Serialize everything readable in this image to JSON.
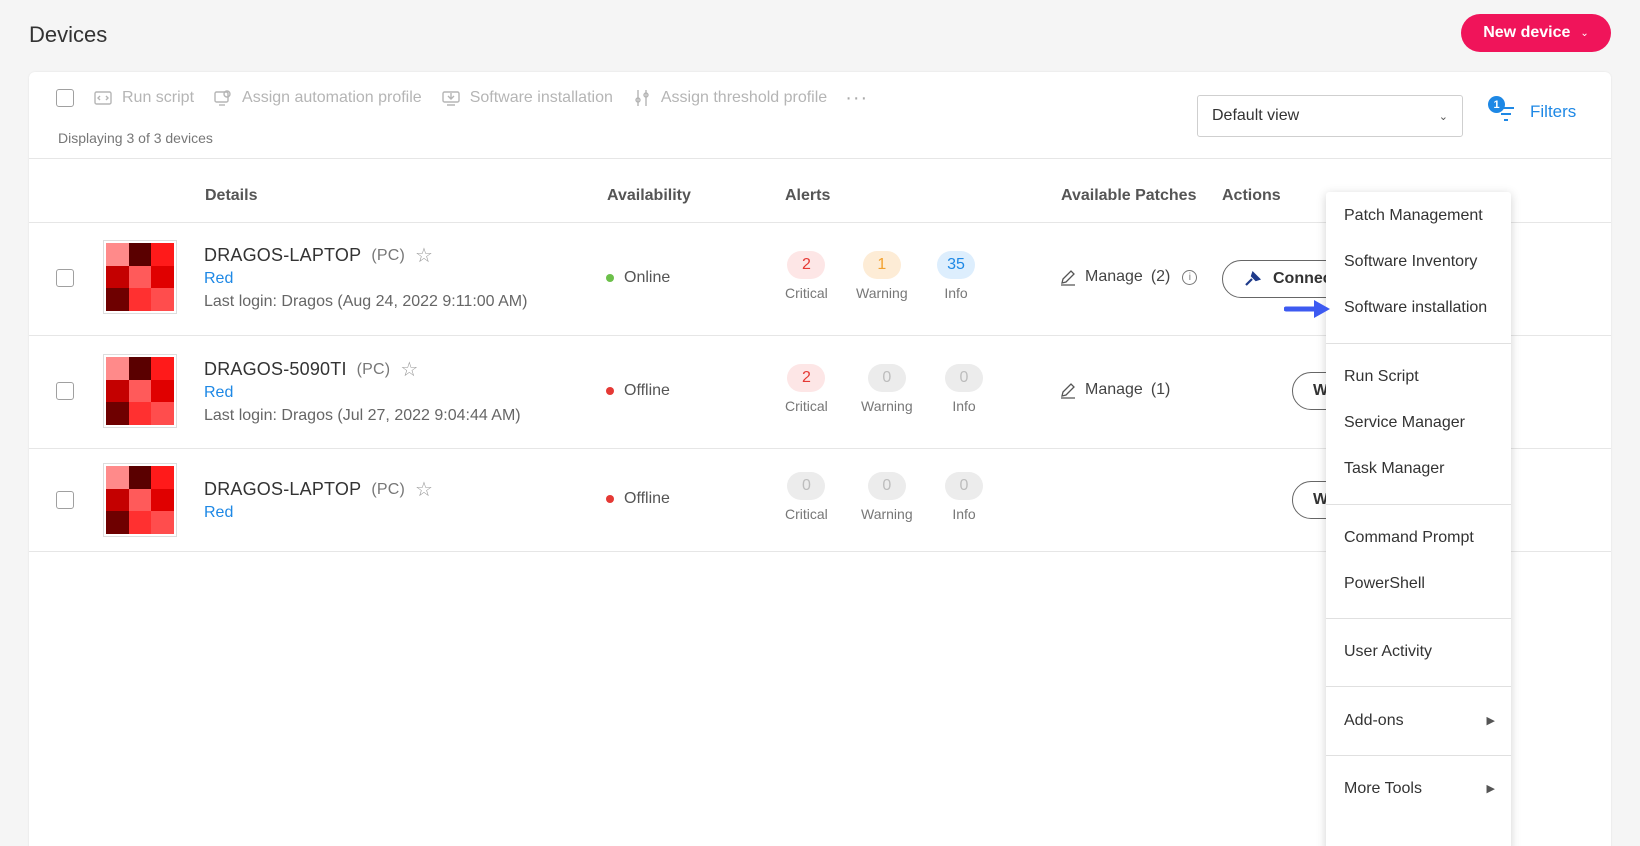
{
  "header": {
    "title": "Devices",
    "new_device_label": "New device"
  },
  "toolbar": {
    "run_script": "Run script",
    "assign_automation": "Assign automation profile",
    "software_installation": "Software installation",
    "assign_threshold": "Assign threshold profile",
    "more": "···",
    "display_count": "Displaying 3 of 3 devices"
  },
  "view": {
    "selected": "Default view"
  },
  "filters": {
    "label": "Filters",
    "count": "1"
  },
  "columns": {
    "details": "Details",
    "availability": "Availability",
    "alerts": "Alerts",
    "patches": "Available Patches",
    "actions": "Actions"
  },
  "devices": [
    {
      "name": "DRAGOS-LAPTOP",
      "type": "(PC)",
      "group": "Red",
      "last_login": "Last login: Dragos (Aug 24, 2022 9:11:00 AM)",
      "availability": "Online",
      "critical": "2",
      "warning": "1",
      "info": "35",
      "patches": "Manage",
      "patch_count": "(2)",
      "action": "Connect"
    },
    {
      "name": "DRAGOS-5090TI",
      "type": "(PC)",
      "group": "Red",
      "last_login": "Last login: Dragos (Jul 27, 2022 9:04:44 AM)",
      "availability": "Offline",
      "critical": "2",
      "warning": "0",
      "info": "0",
      "patches": "Manage",
      "patch_count": "(1)",
      "action": "W"
    },
    {
      "name": "DRAGOS-LAPTOP",
      "type": "(PC)",
      "group": "Red",
      "availability": "Offline",
      "critical": "0",
      "warning": "0",
      "info": "0",
      "action": "W"
    }
  ],
  "alert_labels": {
    "critical": "Critical",
    "warning": "Warning",
    "info": "Info"
  },
  "menu": {
    "patch_management": "Patch Management",
    "software_inventory": "Software Inventory",
    "software_installation": "Software installation",
    "run_script": "Run Script",
    "service_manager": "Service Manager",
    "task_manager": "Task Manager",
    "command_prompt": "Command Prompt",
    "powershell": "PowerShell",
    "user_activity": "User Activity",
    "add_ons": "Add-ons",
    "more_tools": "More Tools"
  },
  "colors": {
    "brand": "#f0145a",
    "link": "#1e88e5",
    "online": "#6cc04a",
    "offline": "#e53935",
    "thumb_colors": [
      "#ff8a8a",
      "#5a0000",
      "#ff1a1a",
      "#c40000",
      "#ff5a5a",
      "#e00000",
      "#6e0000",
      "#ff3030",
      "#ff4d4d"
    ]
  }
}
